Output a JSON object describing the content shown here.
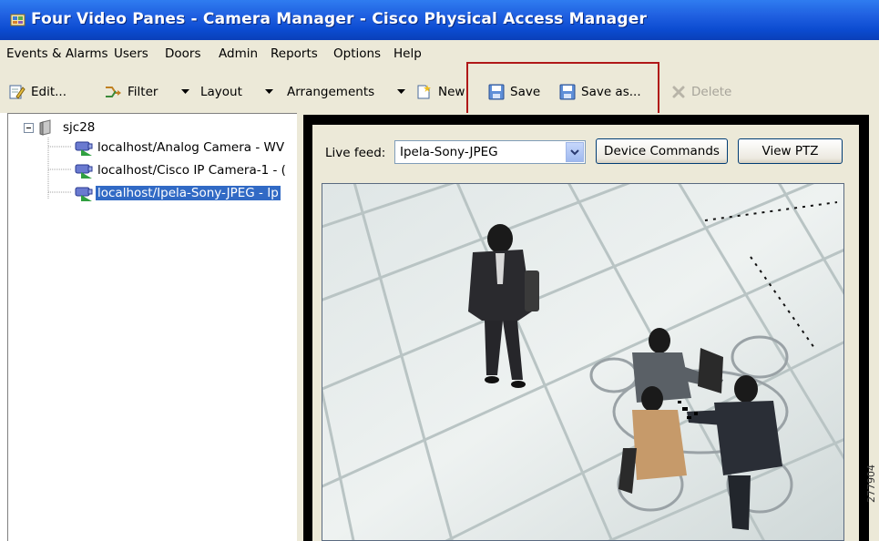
{
  "window": {
    "title": "Four Video Panes - Camera Manager - Cisco Physical Access Manager",
    "titlebar_color": "#0b4bd0"
  },
  "menu": [
    "Events & Alarms",
    "Users",
    "Doors",
    "Admin",
    "Reports",
    "Options",
    "Help"
  ],
  "toolbar": {
    "edit": "Edit...",
    "filter": "Filter",
    "layout": "Layout",
    "arrangements": "Arrangements",
    "new": "New",
    "save": "Save",
    "save_as": "Save as...",
    "delete": "Delete"
  },
  "highlight_color": "#b01818",
  "tree": {
    "root": "sjc28",
    "cameras": [
      "localhost/Analog Camera - WV",
      "localhost/Cisco IP Camera-1 - (",
      "localhost/Ipela-Sony-JPEG - Ip"
    ],
    "selected_index": 2
  },
  "video_pane": {
    "live_feed_label": "Live feed:",
    "live_feed_value": "Ipela-Sony-JPEG",
    "device_commands": "Device Commands",
    "view_ptz": "View PTZ"
  },
  "figure_number": "277904"
}
